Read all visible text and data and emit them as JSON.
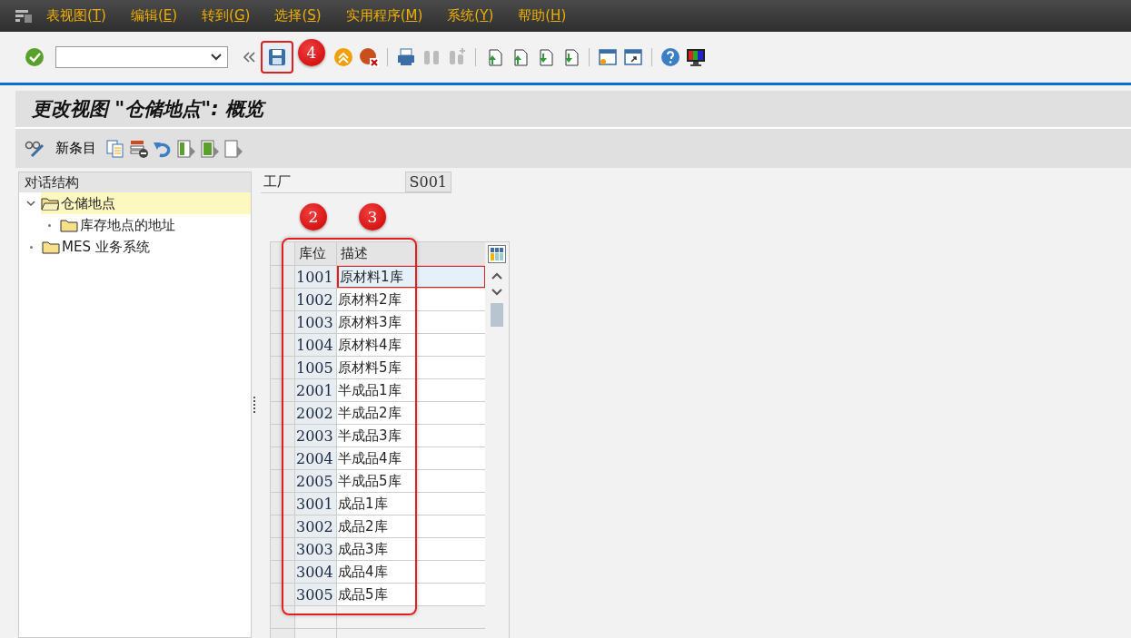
{
  "menu_bar": {
    "items": [
      {
        "label": "表视图(T)"
      },
      {
        "label": "编辑(E)"
      },
      {
        "label": "转到(G)"
      },
      {
        "label": "选择(S)"
      },
      {
        "label": "实用程序(M)"
      },
      {
        "label": "系统(Y)"
      },
      {
        "label": "帮助(H)"
      }
    ]
  },
  "toolbar": {
    "save_button": {
      "annotation": "4"
    }
  },
  "title": "更改视图 \"仓储地点\": 概览",
  "app_toolbar": {
    "new_entries": "新条目"
  },
  "tree": {
    "header": "对话结构",
    "items": [
      {
        "label": "仓储地点",
        "kind": "branch",
        "expanded": true,
        "selected": true,
        "children": [
          {
            "label": "库存地点的地址",
            "kind": "leaf",
            "selected": false
          }
        ]
      },
      {
        "label": "MES 业务系统",
        "kind": "leaf",
        "selected": false
      }
    ]
  },
  "plant": {
    "label": "工厂",
    "value": "S001"
  },
  "table": {
    "columns": [
      {
        "label": "库位",
        "annotation": "2"
      },
      {
        "label": "描述",
        "annotation": "3"
      }
    ],
    "rows": [
      {
        "code": "1001",
        "description": "原材料1库",
        "selected": true
      },
      {
        "code": "1002",
        "description": "原材料2库",
        "selected": false
      },
      {
        "code": "1003",
        "description": "原材料3库",
        "selected": false
      },
      {
        "code": "1004",
        "description": "原材料4库",
        "selected": false
      },
      {
        "code": "1005",
        "description": "原材料5库",
        "selected": false
      },
      {
        "code": "2001",
        "description": "半成品1库",
        "selected": false
      },
      {
        "code": "2002",
        "description": "半成品2库",
        "selected": false
      },
      {
        "code": "2003",
        "description": "半成品3库",
        "selected": false
      },
      {
        "code": "2004",
        "description": "半成品4库",
        "selected": false
      },
      {
        "code": "2005",
        "description": "半成品5库",
        "selected": false
      },
      {
        "code": "3001",
        "description": "成品1库",
        "selected": false
      },
      {
        "code": "3002",
        "description": "成品2库",
        "selected": false
      },
      {
        "code": "3003",
        "description": "成品3库",
        "selected": false
      },
      {
        "code": "3004",
        "description": "成品4库",
        "selected": false
      },
      {
        "code": "3005",
        "description": "成品5库",
        "selected": false
      }
    ]
  }
}
